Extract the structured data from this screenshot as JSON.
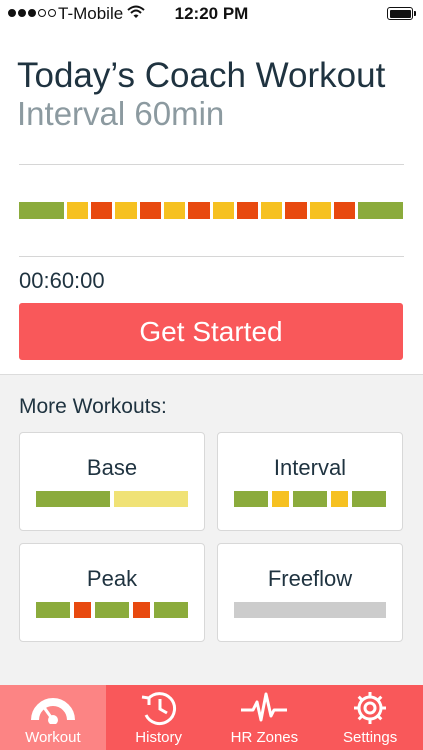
{
  "status_bar": {
    "carrier": "T-Mobile",
    "time": "12:20 PM"
  },
  "header": {
    "title": "Today’s Coach Workout",
    "subtitle": "Interval 60min"
  },
  "workout_profile": [
    {
      "zone": "green",
      "w": 44
    },
    {
      "zone": "yellow",
      "w": 21
    },
    {
      "zone": "red",
      "w": 21
    },
    {
      "zone": "yellow",
      "w": 21
    },
    {
      "zone": "red",
      "w": 21
    },
    {
      "zone": "yellow",
      "w": 21
    },
    {
      "zone": "red",
      "w": 21
    },
    {
      "zone": "yellow",
      "w": 21
    },
    {
      "zone": "red",
      "w": 21
    },
    {
      "zone": "yellow",
      "w": 21
    },
    {
      "zone": "red",
      "w": 21
    },
    {
      "zone": "yellow",
      "w": 21
    },
    {
      "zone": "red",
      "w": 21
    },
    {
      "zone": "green",
      "w": 44
    }
  ],
  "zone_colors": {
    "green": "#8bab3c",
    "yellow": "#f6c121",
    "red": "#e8490f",
    "pale_yellow": "#f0e276",
    "gray": "#cccccc"
  },
  "duration": "00:60:00",
  "start_button_label": "Get Started",
  "more_workouts": {
    "heading": "More Workouts:",
    "cards": [
      {
        "name": "Base",
        "segments": [
          {
            "zone": "green",
            "w": 1
          },
          {
            "zone": "pale_yellow",
            "w": 1
          }
        ]
      },
      {
        "name": "Interval",
        "segments": [
          {
            "zone": "green",
            "w": 33
          },
          {
            "zone": "yellow",
            "w": 17
          },
          {
            "zone": "green",
            "w": 33
          },
          {
            "zone": "yellow",
            "w": 17
          },
          {
            "zone": "green",
            "w": 33
          }
        ]
      },
      {
        "name": "Peak",
        "segments": [
          {
            "zone": "green",
            "w": 33
          },
          {
            "zone": "red",
            "w": 17
          },
          {
            "zone": "green",
            "w": 33
          },
          {
            "zone": "red",
            "w": 17
          },
          {
            "zone": "green",
            "w": 33
          }
        ]
      },
      {
        "name": "Freeflow",
        "segments": [
          {
            "zone": "gray",
            "w": 1
          }
        ]
      }
    ]
  },
  "tabs": [
    {
      "label": "Workout",
      "icon": "gauge-icon",
      "active": true
    },
    {
      "label": "History",
      "icon": "history-clock-icon",
      "active": false
    },
    {
      "label": "HR Zones",
      "icon": "heartbeat-icon",
      "active": false
    },
    {
      "label": "Settings",
      "icon": "gear-icon",
      "active": false
    }
  ]
}
